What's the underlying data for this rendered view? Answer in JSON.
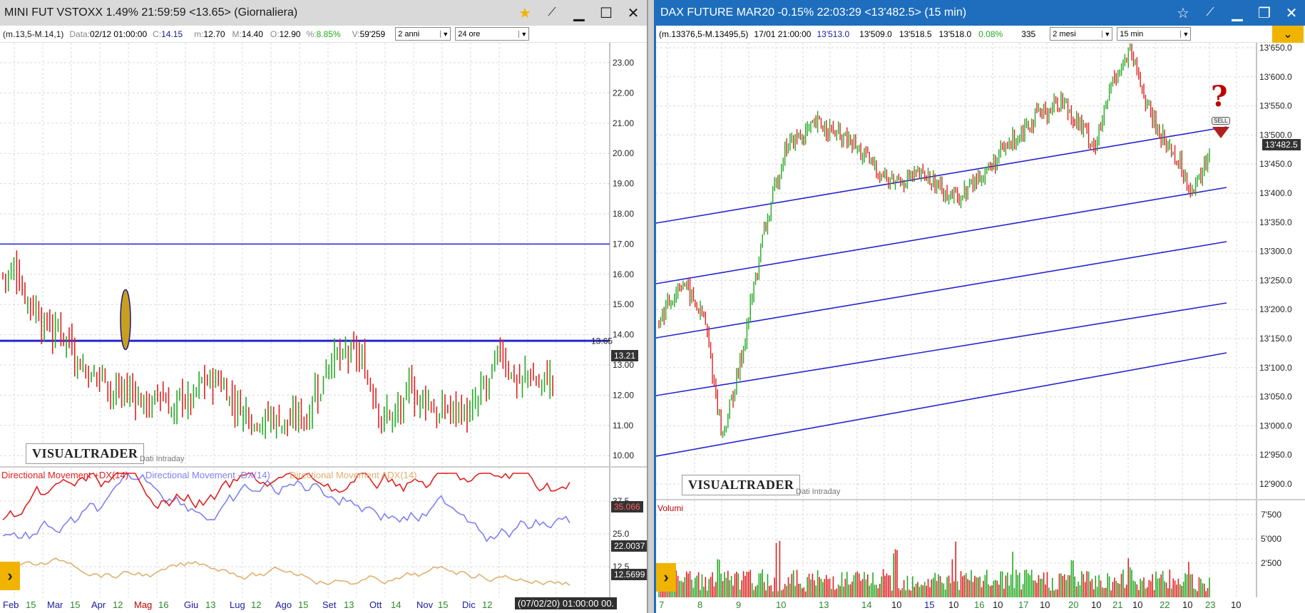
{
  "left": {
    "title": "MINI FUT VSTOXX 1.49% 21:59:59  <13.65> (Giornaliera)",
    "info": {
      "range": "(m.13,5-M.14,1)",
      "data_label": "Data:",
      "data_value": "02/12 01:00:00",
      "c_label": "C:",
      "c_value": "14.15",
      "m_label": "m:",
      "m_value": "12.70",
      "M_label": "M:",
      "M_value": "14.40",
      "o_label": "O:",
      "o_value": "12.90",
      "pct_label": "%:",
      "pct_value": "8.85%",
      "v_label": "V:",
      "v_value": "59'259",
      "period_select": "2 anni",
      "interval_select": "24 ore"
    },
    "y_ticks": [
      "23.00",
      "22.00",
      "21.00",
      "20.00",
      "19.00",
      "18.00",
      "17.00",
      "16.00",
      "15.00",
      "14.00",
      "13.00",
      "12.00",
      "11.00",
      "10.00"
    ],
    "last_price_tag": "13.21",
    "ghost_price": "13.65",
    "logo": "VISUALTRADER",
    "intraday_note": "Dati Intraday",
    "indicator_labels": {
      "plus_dx": "Directional Movement +DX(14)",
      "minus_dx": "Directional Movement -DX(14)",
      "adx": "Directional Movement ADX(14)"
    },
    "ind_ticks": [
      "37.5",
      "25.0",
      "12.5"
    ],
    "ind_tags": {
      "plus_dx": "35.066",
      "minus_dx": "22.0037",
      "adx": "12.5699"
    },
    "x_labels": [
      {
        "t": "Feb",
        "c": "#1a1aa0"
      },
      {
        "t": "15",
        "c": "#2a8a2a"
      },
      {
        "t": "Mar",
        "c": "#1a1aa0"
      },
      {
        "t": "15",
        "c": "#2a8a2a"
      },
      {
        "t": "Apr",
        "c": "#1a1aa0"
      },
      {
        "t": "12",
        "c": "#2a8a2a"
      },
      {
        "t": "Mag",
        "c": "#c00000"
      },
      {
        "t": "16",
        "c": "#2a8a2a"
      },
      {
        "t": "Giu",
        "c": "#1a1aa0"
      },
      {
        "t": "13",
        "c": "#2a8a2a"
      },
      {
        "t": "Lug",
        "c": "#1a1aa0"
      },
      {
        "t": "12",
        "c": "#2a8a2a"
      },
      {
        "t": "Ago",
        "c": "#1a1aa0"
      },
      {
        "t": "15",
        "c": "#2a8a2a"
      },
      {
        "t": "Set",
        "c": "#1a1aa0"
      },
      {
        "t": "13",
        "c": "#2a8a2a"
      },
      {
        "t": "Ott",
        "c": "#1a1aa0"
      },
      {
        "t": "14",
        "c": "#2a8a2a"
      },
      {
        "t": "Nov",
        "c": "#1a1aa0"
      },
      {
        "t": "15",
        "c": "#2a8a2a"
      },
      {
        "t": "Dic",
        "c": "#1a1aa0"
      },
      {
        "t": "12",
        "c": "#2a8a2a"
      }
    ],
    "crosshair_date": "(07/02/20) 01:00:00 00."
  },
  "right": {
    "title": "DAX FUTURE MAR20 -0.15% 22:03:29  <13'482.5> (15 min)",
    "info": {
      "range": "(m.13376,5-M.13495,5)",
      "date": "17/01 21:00:00",
      "v1": "13'513.0",
      "v2": "13'509.0",
      "v3": "13'518.5",
      "v4": "13'518.0",
      "pct": "0.08%",
      "vol": "335",
      "period_select": "2 mesi",
      "interval_select": "15 min"
    },
    "y_ticks": [
      "13'650.0",
      "13'600.0",
      "13'550.0",
      "13'500.0",
      "13'450.0",
      "13'400.0",
      "13'350.0",
      "13'300.0",
      "13'250.0",
      "13'200.0",
      "13'150.0",
      "13'100.0",
      "13'050.0",
      "13'000.0",
      "12'950.0",
      "12'900.0"
    ],
    "last_price_tag": "13'482.5",
    "logo": "VISUALTRADER",
    "intraday_note": "Dati Intraday",
    "question_mark": "?",
    "sell_label": "SELL",
    "volume_label": "Volumi",
    "vol_ticks": [
      "7'500",
      "5'000",
      "2'500"
    ],
    "x_labels": [
      "7",
      "8",
      "9",
      "10",
      "13",
      "14",
      "10",
      "15",
      "10",
      "16",
      "10",
      "17",
      "10",
      "20",
      "10",
      "21",
      "10",
      "22",
      "10",
      "23",
      "10"
    ]
  },
  "colors": {
    "up": "#22aa22",
    "down": "#e02020",
    "trendline": "#2424d0",
    "plus_dx": "#e02020",
    "minus_dx": "#8080f0",
    "adx": "#e0b070",
    "marker": "#c8a020"
  },
  "icons": {
    "star": "star-icon",
    "pin": "pin-icon",
    "minimize": "minimize-icon",
    "maximize": "maximize-icon",
    "close": "close-icon",
    "expand": "chevron-right-icon",
    "dropdown": "chevron-down-icon"
  }
}
